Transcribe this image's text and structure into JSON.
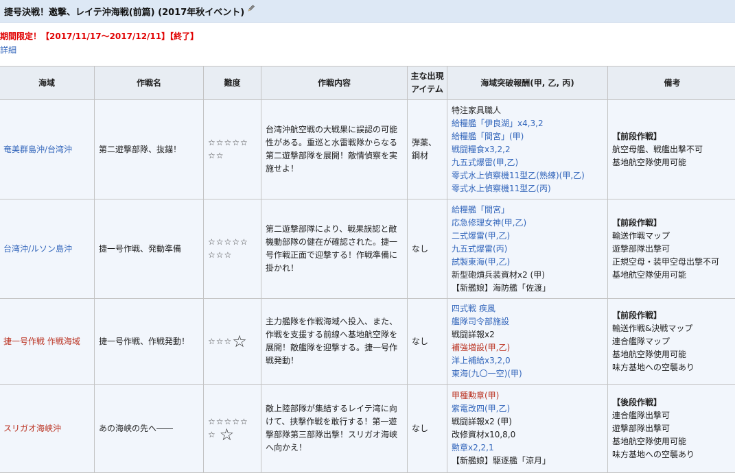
{
  "event": {
    "title": "捷号決戦！邀撃、レイテ沖海戦(前篇) (2017年秋イベント)",
    "notice": "期間限定！【2017/11/17～2017/12/11】【終了】",
    "detail_link": "詳細"
  },
  "table": {
    "headers": {
      "area": "海域",
      "op_name": "作戦名",
      "difficulty": "難度",
      "content": "作戦内容",
      "items": "主な出現アイテム",
      "rewards": "海域突破報酬(甲, 乙, 丙)",
      "notes": "備考"
    },
    "rows": [
      {
        "area": "奄美群島沖/台湾沖",
        "area_color": "#3366bb",
        "op_name": "第二遊撃部隊、抜錨！",
        "stars_line1": "☆☆☆☆☆",
        "stars_line2": "☆☆",
        "big_star": "",
        "content": "台湾沖航空戦の大戦果に誤認の可能性がある。重巡と水雷戦隊からなる第二遊撃部隊を展開！敵情偵察を実施せよ！",
        "items": "弾薬、鋼材",
        "rewards": [
          {
            "text": "特注家具職人",
            "style": "plain"
          },
          {
            "text": "給糧艦「伊良湖」x4,3,2",
            "style": "lnk"
          },
          {
            "text": "給糧艦「間宮」(甲)",
            "style": "lnk"
          },
          {
            "text": "戦闘糧食x3,2,2",
            "style": "lnk"
          },
          {
            "text": "九五式爆雷(甲,乙)",
            "style": "lnk"
          },
          {
            "text": "零式水上偵察機11型乙(熟練)(甲,乙)",
            "style": "lnk"
          },
          {
            "text": "零式水上偵察機11型乙(丙)",
            "style": "lnk"
          }
        ],
        "notes": {
          "heading": "【前段作戦】",
          "lines": [
            "航空母艦、戦艦出撃不可",
            "基地航空隊使用可能"
          ]
        }
      },
      {
        "area": "台湾沖/ルソン島沖",
        "area_color": "#3366bb",
        "op_name": "捷一号作戦、発動準備",
        "stars_line1": "☆☆☆☆☆",
        "stars_line2": "☆☆☆",
        "big_star": "",
        "content": "第二遊撃部隊により、戦果誤認と敵機動部隊の健在が確認された。捷一号作戦正面で迎撃する！作戦準備に掛かれ！",
        "items": "なし",
        "rewards": [
          {
            "text": "給糧艦「間宮」",
            "style": "lnk"
          },
          {
            "text": "応急修理女神(甲,乙)",
            "style": "lnk"
          },
          {
            "text": "二式爆雷(甲,乙)",
            "style": "lnk"
          },
          {
            "text": "九五式爆雷(丙)",
            "style": "lnk"
          },
          {
            "text": "試製東海(甲,乙)",
            "style": "lnk"
          },
          {
            "text": "新型砲熕兵装資材x2 (甲)",
            "style": "plain"
          },
          {
            "text": "【新艦娘】海防艦「佐渡」",
            "style": "plain"
          }
        ],
        "notes": {
          "heading": "【前段作戦】",
          "lines": [
            "輸送作戦マップ",
            "遊撃部隊出撃可",
            "正規空母・装甲空母出撃不可",
            "基地航空隊使用可能"
          ]
        }
      },
      {
        "area": "捷一号作戦 作戦海域",
        "area_color": "#bb3322",
        "op_name": "捷一号作戦、作戦発動！",
        "stars_line1": "☆☆☆",
        "stars_line2": "",
        "big_star": "☆",
        "content": "主力艦隊を作戦海域へ投入、また、作戦を支援する前線へ基地航空隊を展開！敵艦隊を迎撃する。捷一号作戦発動！",
        "items": "なし",
        "rewards": [
          {
            "text": "四式戦 疾風",
            "style": "lnk"
          },
          {
            "text": "艦隊司令部施設",
            "style": "lnk"
          },
          {
            "text": "戦闘詳報x2",
            "style": "plain"
          },
          {
            "text": "補強増設(甲,乙)",
            "style": "lnkred"
          },
          {
            "text": "洋上補給x3,2,0",
            "style": "lnk"
          },
          {
            "text": "東海(九〇一空)(甲)",
            "style": "lnk"
          }
        ],
        "notes": {
          "heading": "【前段作戦】",
          "lines": [
            "輸送作戦&決戦マップ",
            "連合艦隊マップ",
            "基地航空隊使用可能",
            "味方基地への空襲あり"
          ]
        }
      },
      {
        "area": "スリガオ海峡沖",
        "area_color": "#bb3322",
        "op_name": "あの海峡の先へ――",
        "stars_line1": "☆☆☆☆☆",
        "stars_line2": "☆",
        "big_star": "☆",
        "content": "敵上陸部隊が集結するレイテ湾に向けて、挟撃作戦を敢行する！第一遊撃部隊第三部隊出撃！スリガオ海峡へ向かえ！",
        "items": "なし",
        "rewards": [
          {
            "text": "甲種勲章(甲)",
            "style": "lnkred"
          },
          {
            "text": "紫電改四(甲,乙)",
            "style": "lnk"
          },
          {
            "text": "戦闘詳報x2 (甲)",
            "style": "plain"
          },
          {
            "text": "改修資材x10,8,0",
            "style": "plain"
          },
          {
            "text": "勲章x2,2,1",
            "style": "lnk"
          },
          {
            "text": "【新艦娘】駆逐艦「涼月」",
            "style": "plain"
          }
        ],
        "notes": {
          "heading": "【後段作戦】",
          "lines": [
            "連合艦隊出撃可",
            "遊撃部隊出撃可",
            "基地航空隊使用可能",
            "味方基地への空襲あり"
          ]
        }
      }
    ]
  }
}
